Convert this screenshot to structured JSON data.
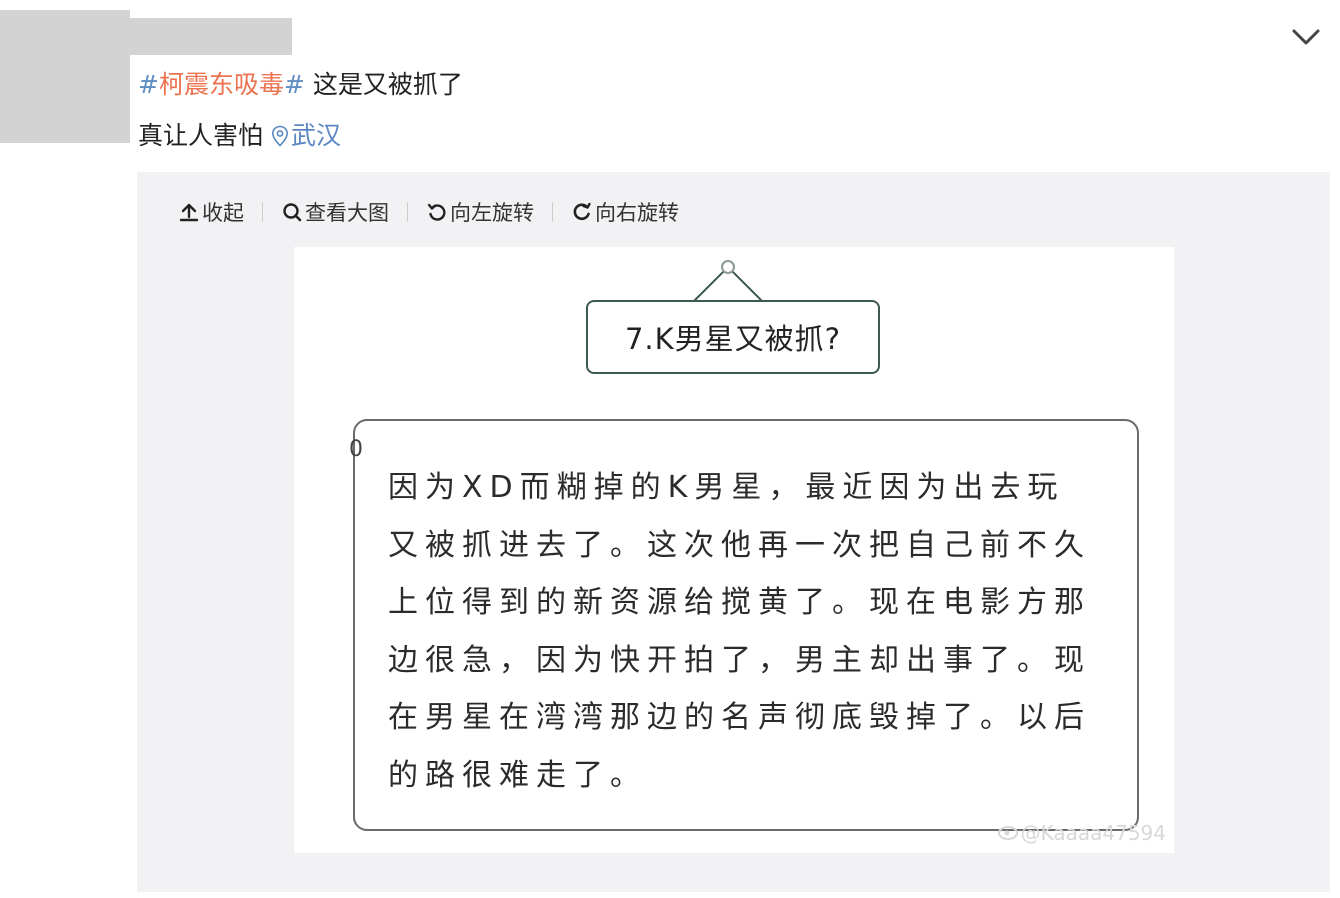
{
  "post": {
    "hashtag": "柯震东吸毒",
    "hash_mark": "#",
    "text1": " 这是又被抓了",
    "text2": "真让人害怕",
    "location": "武汉"
  },
  "toolbar": {
    "collapse": "收起",
    "view_large": "查看大图",
    "rotate_left": "向左旋转",
    "rotate_right": "向右旋转"
  },
  "image": {
    "title": "7.K男星又被抓?",
    "corner_mark": "0",
    "body": "因为XD而糊掉的K男星，最近因为出去玩又被抓进去了。这次他再一次把自己前不久上位得到的新资源给搅黄了。现在电影方那边很急，因为快开拍了，男主却出事了。现在男星在湾湾那边的名声彻底毁掉了。以后的路很难走了。",
    "watermark": "@Kaaaa47594"
  },
  "icons": [
    "chevron-down-icon",
    "location-pin-icon",
    "upload-arrow-icon",
    "magnifier-icon",
    "rotate-left-icon",
    "rotate-right-icon",
    "weibo-logo-icon"
  ],
  "colors": {
    "hashtag": "#eb7350",
    "link": "#5b86c2",
    "card_bg": "#f2f2f5"
  }
}
